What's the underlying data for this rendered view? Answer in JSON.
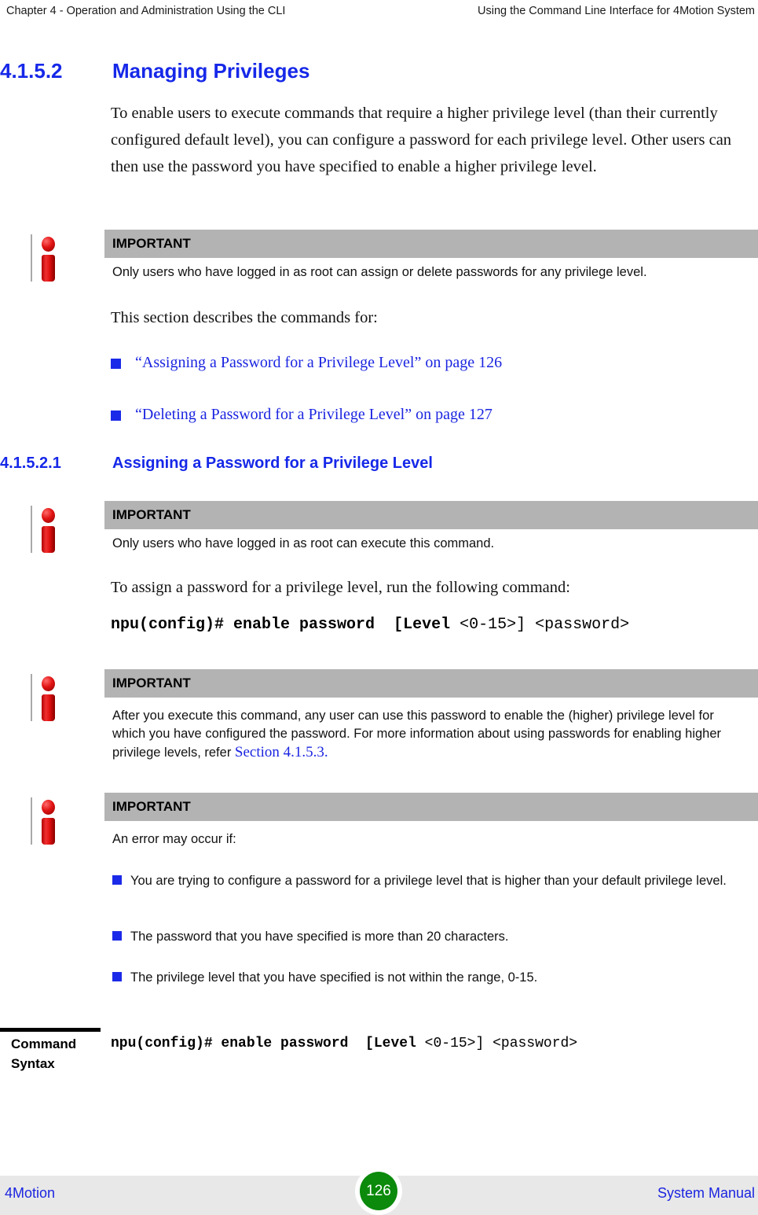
{
  "header": {
    "left": "Chapter 4 - Operation and Administration Using the CLI",
    "right": "Using the Command Line Interface for 4Motion System"
  },
  "section_heading": {
    "number": "4.1.5.2",
    "title": "Managing Privileges"
  },
  "intro_paragraph": "To enable users to execute commands that require a higher privilege level (than their currently configured default level), you can configure a password for each privilege level. Other users can then use the password you have specified to enable a higher privilege level.",
  "note_1": {
    "label": "IMPORTANT",
    "text": "Only users who have logged in as root can assign or delete passwords for any privilege level.",
    "icon": "important-info-icon"
  },
  "section_lead_in": "This section describes the commands for:",
  "cross_references": [
    "“Assigning a Password for a Privilege Level” on page 126",
    "“Deleting a Password for a Privilege Level” on page 127"
  ],
  "subsection_heading": {
    "number": "4.1.5.2.1",
    "title": "Assigning a Password for a Privilege Level"
  },
  "note_2": {
    "label": "IMPORTANT",
    "text": "Only users who have logged in as root can execute this command.",
    "icon": "important-info-icon"
  },
  "assign_paragraph": "To assign a password for a privilege level, run the following command:",
  "command_line": {
    "bold_prefix": "npu(config)# enable password  [",
    "bold_keyword": "Level",
    "regular_suffix": " <0-15>] <password>"
  },
  "note_3": {
    "label": "IMPORTANT",
    "text_before_link": "After you execute this command, any user can use this password to enable the (higher) privilege level for which you have configured the password. For more information about using passwords for enabling higher privilege levels, refer ",
    "link_text": "Section 4.1.5.3.",
    "icon": "important-info-icon"
  },
  "note_4": {
    "label": "IMPORTANT",
    "intro": "An error may occur if:",
    "bullets": [
      "You are trying to configure a password for a privilege level that is higher than your default privilege level.",
      " The password that you have specified is more than 20 characters.",
      "The privilege level that you have specified is not within the range, 0-15."
    ],
    "icon": "important-info-icon"
  },
  "command_syntax": {
    "label_line1": "Command",
    "label_line2": "Syntax",
    "bold_prefix": "npu(config)# enable password  [",
    "bold_keyword": "Level",
    "regular_suffix": " <0-15>] <password>"
  },
  "footer": {
    "left": "4Motion",
    "page_number": "126",
    "right": "System Manual"
  },
  "colors": {
    "heading_blue": "#1628e8",
    "link_blue": "#1b25e0",
    "note_bar_gray": "#b3b3b3",
    "footer_gray": "#e8e8e8",
    "page_badge_green": "#0b8a0b",
    "icon_red": "#e01010"
  }
}
